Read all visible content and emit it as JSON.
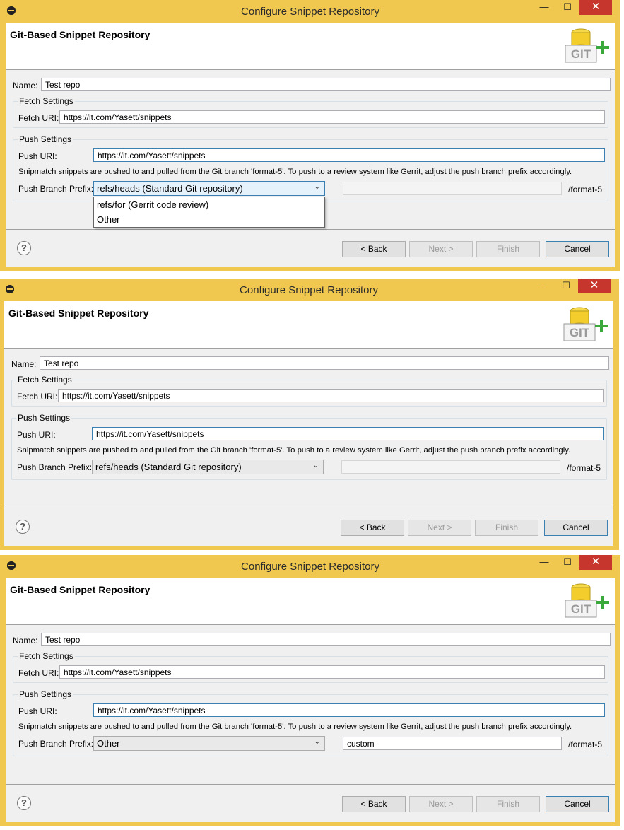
{
  "dialog": {
    "window_title": "Configure Snippet Repository",
    "header_title": "Git-Based Snippet Repository",
    "git_icon_text": "GIT",
    "name_label": "Name:",
    "name_value": "Test repo",
    "fetch_group": "Fetch Settings",
    "fetch_uri_label": "Fetch URI:",
    "fetch_uri_value": "https://it.com/Yasett/snippets",
    "push_group": "Push Settings",
    "push_uri_label": "Push URI:",
    "push_uri_value": "https://it.com/Yasett/snippets",
    "info_text": "Snipmatch snippets are pushed to and pulled from the Git branch 'format-5'. To push to a review system like Gerrit, adjust the push branch prefix accordingly.",
    "prefix_label": "Push Branch Prefix:",
    "suffix": "/format-5",
    "buttons": {
      "back": "< Back",
      "next": "Next >",
      "finish": "Finish",
      "cancel": "Cancel"
    },
    "help_icon": "?",
    "minimize_icon": "—",
    "maximize_icon": "☐",
    "close_icon": "✕",
    "combo_arrow": "⌄"
  },
  "prefix_options": [
    "refs/heads (Standard Git repository)",
    "refs/for (Gerrit code review)",
    "Other"
  ],
  "screens": [
    {
      "selected": "refs/heads (Standard Git repository)",
      "custom_value": "",
      "dropdown_open": true
    },
    {
      "selected": "refs/heads (Standard Git repository)",
      "custom_value": "",
      "dropdown_open": false
    },
    {
      "selected": "Other",
      "custom_value": "custom",
      "dropdown_open": false
    }
  ],
  "colors": {
    "window_frame": "#f0c850",
    "close_button": "#c7362c",
    "focus_border": "#3c7fb1"
  }
}
